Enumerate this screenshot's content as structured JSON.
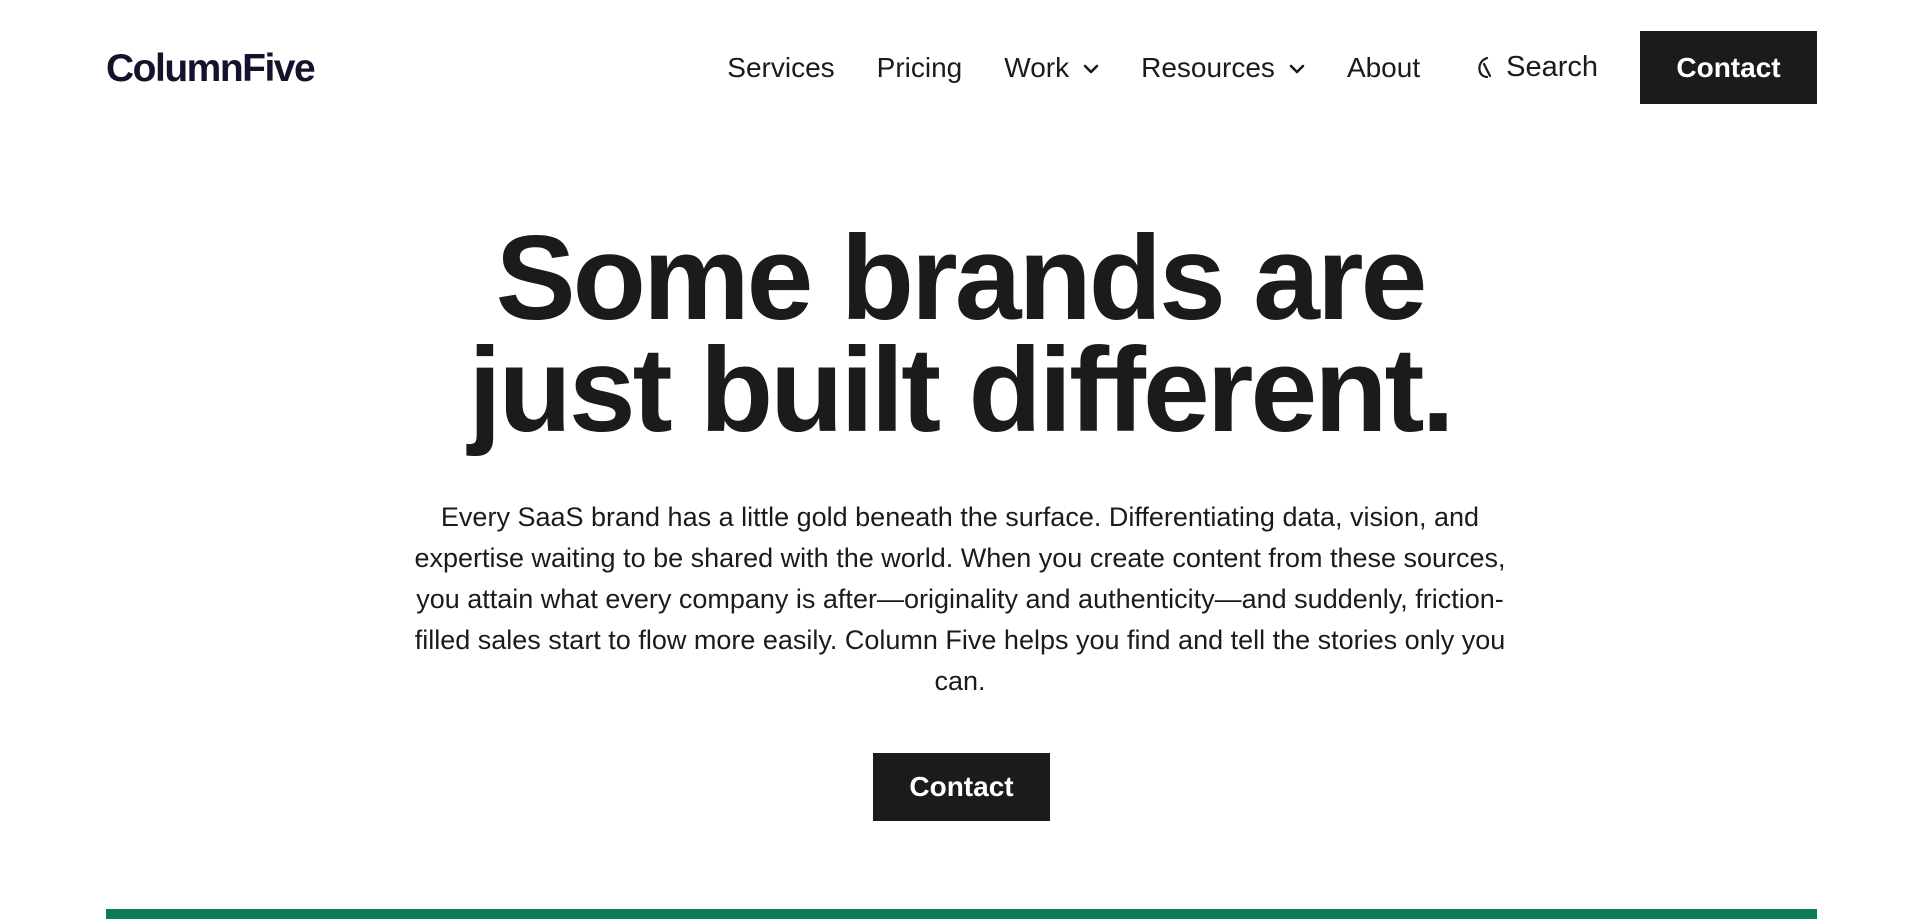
{
  "header": {
    "logo_text": "ColumnFive",
    "nav": {
      "services": "Services",
      "pricing": "Pricing",
      "work": "Work",
      "resources": "Resources",
      "about": "About"
    },
    "search_label": "Search",
    "contact_label": "Contact"
  },
  "hero": {
    "title_line1": "Some brands are",
    "title_line2": "just built different.",
    "body": "Every SaaS brand has a little gold beneath the surface. Differentiating data, vision, and expertise waiting to be shared with the world. When you create content from these sources, you attain what every company is after—originality and authenticity—and suddenly, friction-filled sales start to flow more easily. Column Five helps you find and tell the stories only you can.",
    "cta_label": "Contact"
  },
  "icons": {
    "search": "search-icon",
    "dropdown": "chevron-down-icon"
  },
  "colors": {
    "text": "#1b1a1c",
    "button_bg": "#1b1a1c",
    "button_text": "#ffffff",
    "accent_bar": "#0a7d56",
    "logo": "#15132b"
  }
}
